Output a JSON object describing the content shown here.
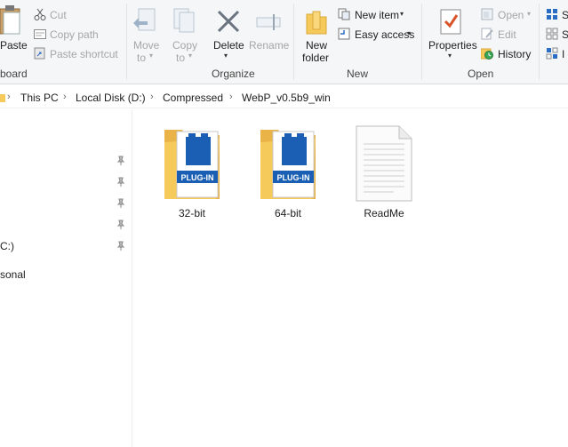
{
  "ribbon": {
    "clipboard": {
      "paste_label": "Paste",
      "cut_label": "Cut",
      "copy_path_label": "Copy path",
      "paste_shortcut_label": "Paste shortcut",
      "group_label": "board"
    },
    "organize": {
      "move_to_label": "Move",
      "move_to_label2": "to",
      "copy_to_label": "Copy",
      "copy_to_label2": "to",
      "delete_label": "Delete",
      "rename_label": "Rename",
      "group_label": "Organize"
    },
    "new": {
      "new_folder_label": "New",
      "new_folder_label2": "folder",
      "new_item_label": "New item",
      "easy_access_label": "Easy access",
      "group_label": "New"
    },
    "open": {
      "properties_label": "Properties",
      "open_label": "Open",
      "edit_label": "Edit",
      "history_label": "History",
      "group_label": "Open"
    },
    "select": {
      "s1": "S",
      "s2": "S",
      "s3": "I"
    }
  },
  "address_bar": {
    "crumbs": [
      "This PC",
      "Local Disk (D:)",
      "Compressed",
      "WebP_v0.5b9_win"
    ]
  },
  "nav_pane": {
    "drive_label": "C:)",
    "personal_label": "sonal"
  },
  "files": [
    {
      "name": "32-bit",
      "type": "folder",
      "badge": "PLUG-IN"
    },
    {
      "name": "64-bit",
      "type": "folder",
      "badge": "PLUG-IN"
    },
    {
      "name": "ReadMe",
      "type": "document"
    }
  ],
  "colors": {
    "folder": "#f6c95b",
    "plugin_blue": "#1a5fb4",
    "accent": "#2b6cc4"
  }
}
